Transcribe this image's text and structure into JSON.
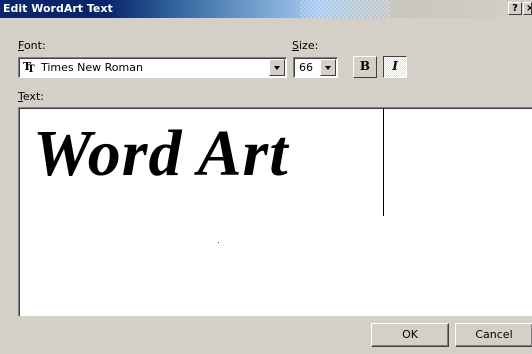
{
  "window": {
    "title": "Edit WordArt Text",
    "help_label": "?",
    "close_label": "×"
  },
  "font": {
    "label": "Font:",
    "value": "Times New Roman"
  },
  "size": {
    "label": "Size:",
    "value": "66"
  },
  "format": {
    "bold_label": "B",
    "italic_label": "I",
    "italic_active": true
  },
  "text": {
    "label": "Text:",
    "value": "Word Art"
  },
  "buttons": {
    "ok_label": "OK",
    "cancel_label": "Cancel"
  },
  "colors": {
    "title_active": "#0a246a",
    "dialog_face": "#d4d0c8"
  },
  "icons": {
    "font_type": "truetype-font-icon"
  }
}
